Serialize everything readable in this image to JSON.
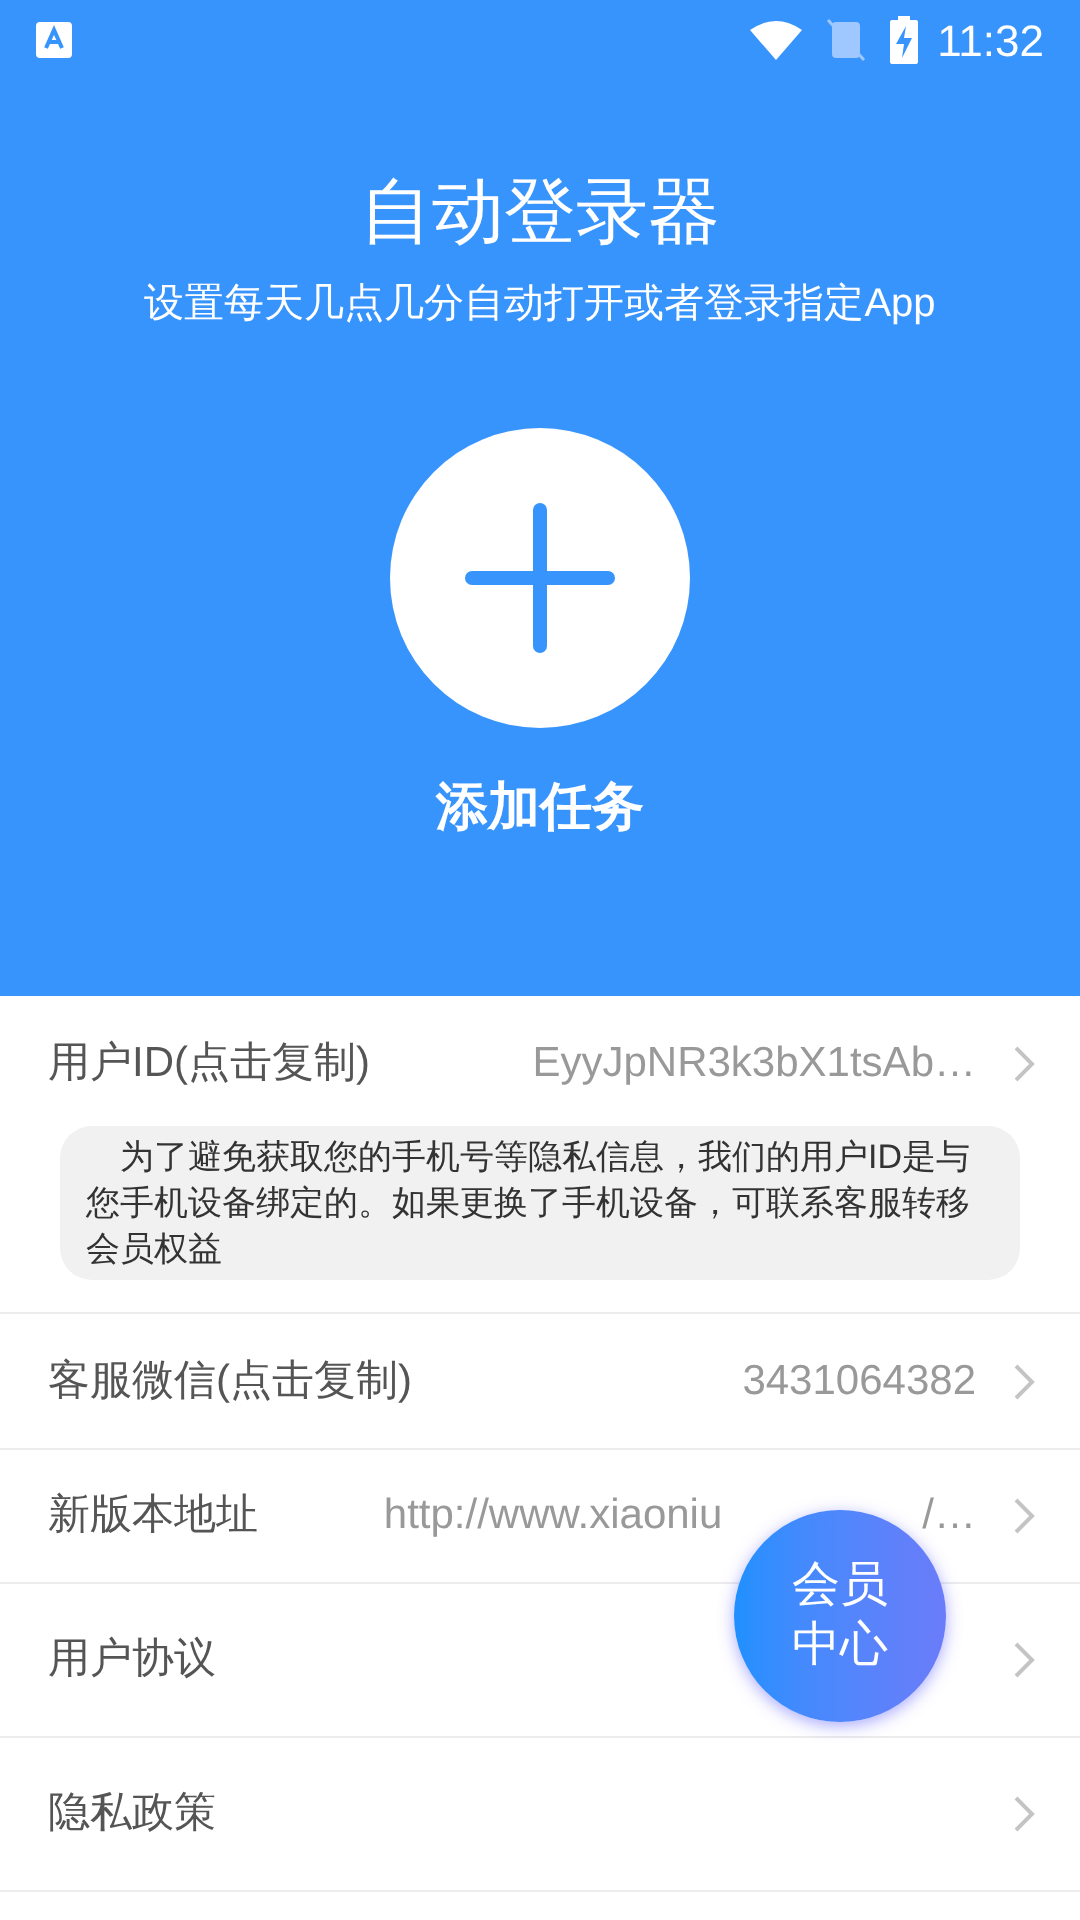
{
  "status_bar": {
    "time": "11:32"
  },
  "header": {
    "title": "自动登录器",
    "subtitle": "设置每天几点几分自动打开或者登录指定App",
    "add_label": "添加任务"
  },
  "rows": [
    {
      "label": "用户ID(点击复制)",
      "value": "EyyJpNR3k3bX1tsAb…",
      "note": "为了避免获取您的手机号等隐私信息，我们的用户ID是与您手机设备绑定的。如果更换了手机设备，可联系客服转移会员权益"
    },
    {
      "label": "客服微信(点击复制)",
      "value": "3431064382"
    },
    {
      "label": "新版本地址",
      "value": "http://www.xiaoniu",
      "value_tail": "/…"
    },
    {
      "label": "用户协议"
    },
    {
      "label": "隐私政策"
    }
  ],
  "fab": {
    "label": "会员中心"
  }
}
